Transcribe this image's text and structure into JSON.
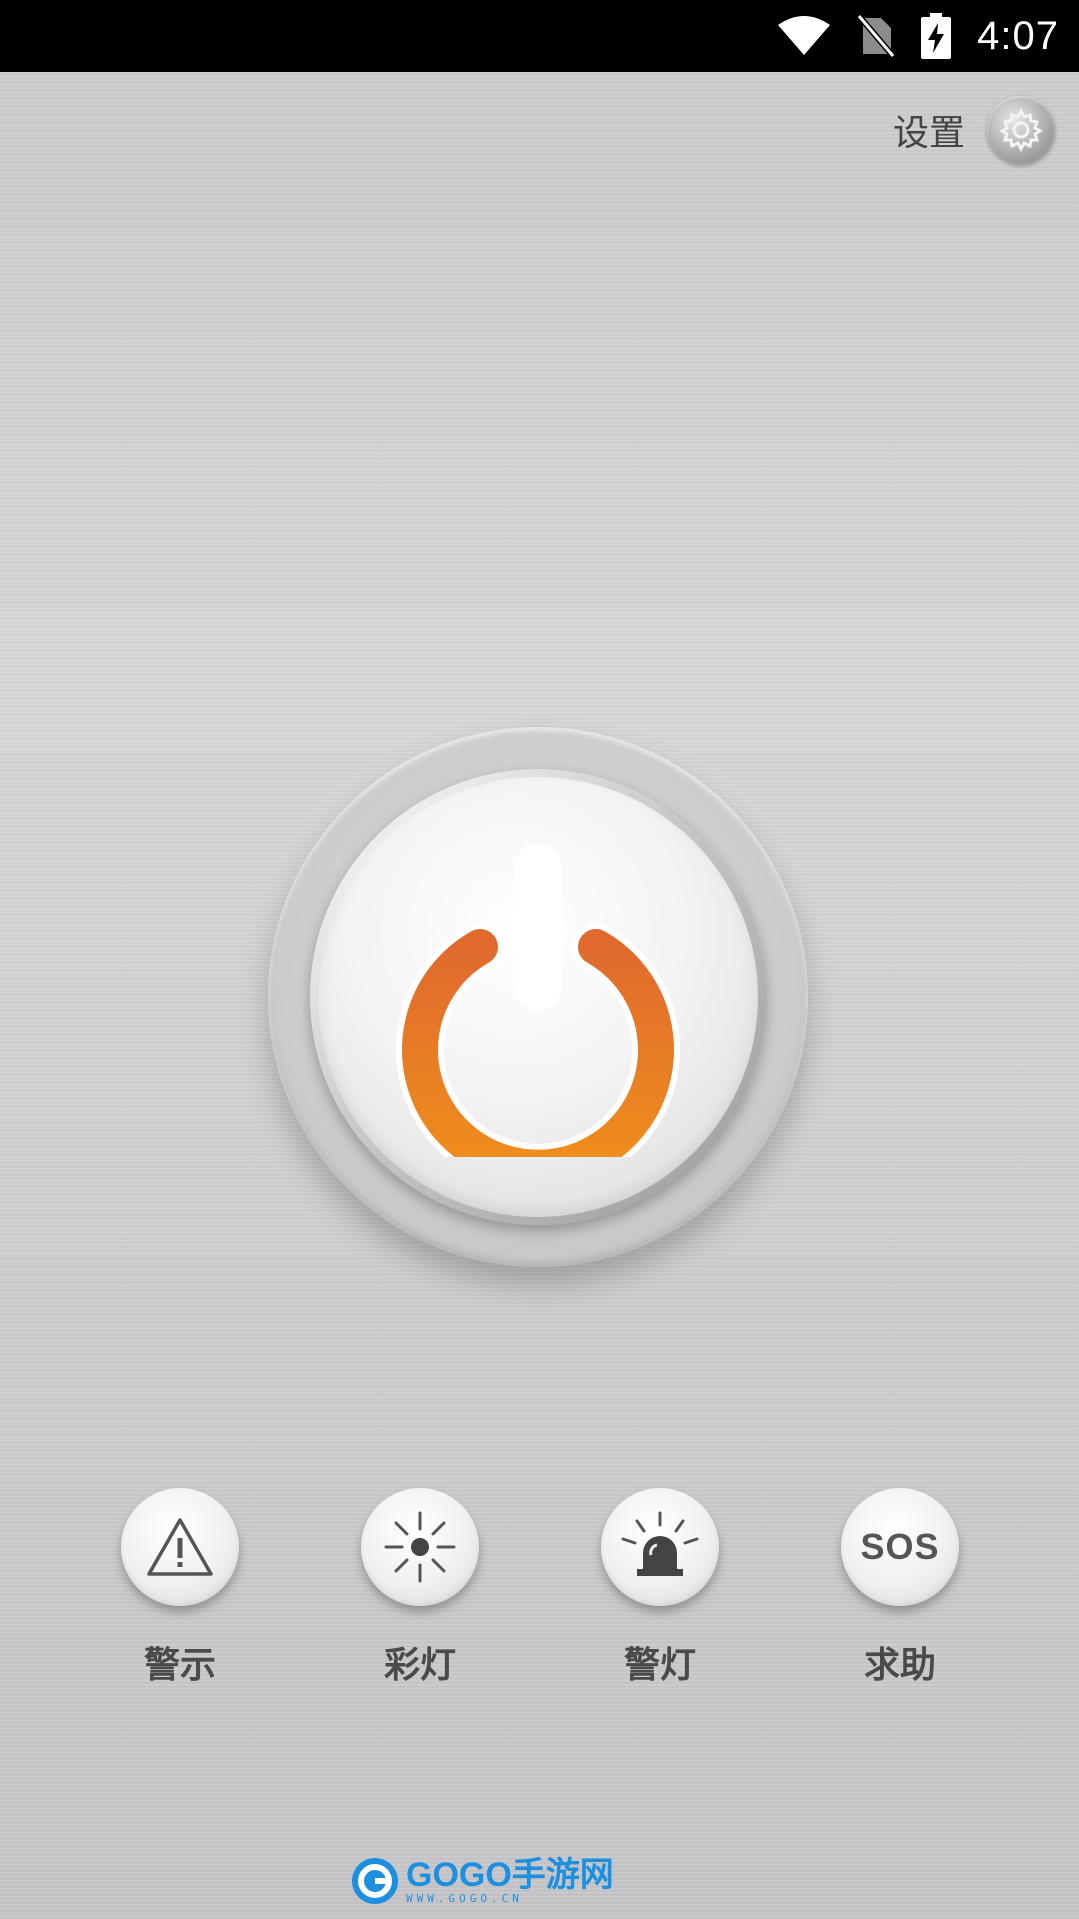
{
  "status_bar": {
    "time": "4:07",
    "icons": [
      "wifi-icon",
      "no-sim-icon",
      "battery-charging-icon"
    ]
  },
  "settings": {
    "label": "设置",
    "icon": "gear-icon"
  },
  "power_button": {
    "icon": "power-icon",
    "accent_color": "#e8852a"
  },
  "modes": [
    {
      "label": "警示",
      "icon": "warning-triangle-icon"
    },
    {
      "label": "彩灯",
      "icon": "sparkle-light-icon"
    },
    {
      "label": "警灯",
      "icon": "siren-icon"
    },
    {
      "label": "求助",
      "icon": "sos-icon",
      "text": "SOS"
    }
  ],
  "watermark": {
    "title": "GOGO手游网",
    "subtitle": "WWW.GOGO.CN"
  }
}
